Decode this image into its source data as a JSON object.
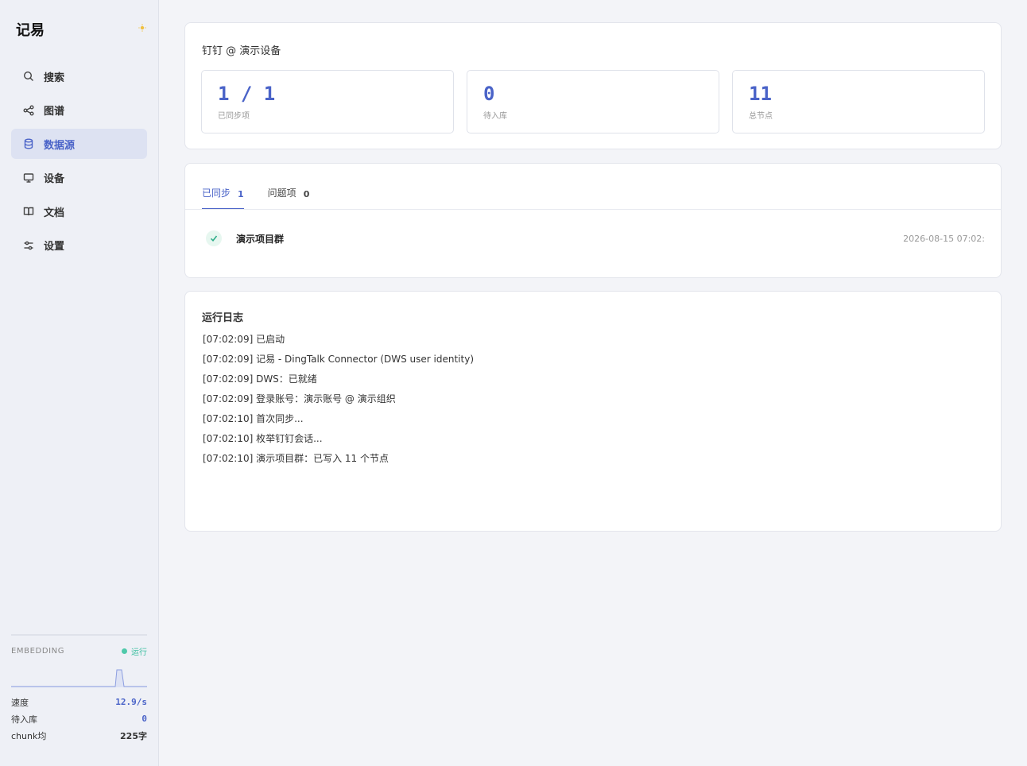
{
  "app": {
    "name": "记易"
  },
  "sidebar": {
    "items": [
      {
        "label": "搜索",
        "icon": "search-icon",
        "active": false
      },
      {
        "label": "图谱",
        "icon": "share-graph-icon",
        "active": false
      },
      {
        "label": "数据源",
        "icon": "database-icon",
        "active": true
      },
      {
        "label": "设备",
        "icon": "monitor-icon",
        "active": false
      },
      {
        "label": "文档",
        "icon": "book-icon",
        "active": false
      },
      {
        "label": "设置",
        "icon": "sliders-icon",
        "active": false
      }
    ]
  },
  "embedding": {
    "title": "EMBEDDING",
    "status": "运行",
    "speed_label": "速度",
    "speed_value": "12.9/s",
    "pending_label": "待入库",
    "pending_value": "0",
    "chunk_label": "chunk均",
    "chunk_value": "225字"
  },
  "source": {
    "title": "钉钉 @ 演示设备",
    "stats": [
      {
        "value": "1 / 1",
        "label": "已同步项"
      },
      {
        "value": "0",
        "label": "待入库"
      },
      {
        "value": "11",
        "label": "总节点"
      }
    ]
  },
  "tabs": [
    {
      "label": "已同步",
      "count": "1",
      "active": true
    },
    {
      "label": "问题项",
      "count": "0",
      "active": false
    }
  ],
  "synced_items": [
    {
      "name": "演示项目群",
      "time": "2026-08-15 07:02:"
    }
  ],
  "log": {
    "title": "运行日志",
    "lines": [
      "[07:02:09] 已启动",
      "[07:02:09] 记易 - DingTalk Connector (DWS user identity)",
      "[07:02:09] DWS：已就绪",
      "[07:02:09] 登录账号：演示账号 @ 演示组织",
      "[07:02:10] 首次同步...",
      "[07:02:10] 枚举钉钉会话...",
      "[07:02:10] 演示项目群：已写入 11 个节点"
    ]
  },
  "colors": {
    "accent": "#4a63c8",
    "success": "#3cbfa0",
    "sidebar_bg": "#eef0f6"
  }
}
